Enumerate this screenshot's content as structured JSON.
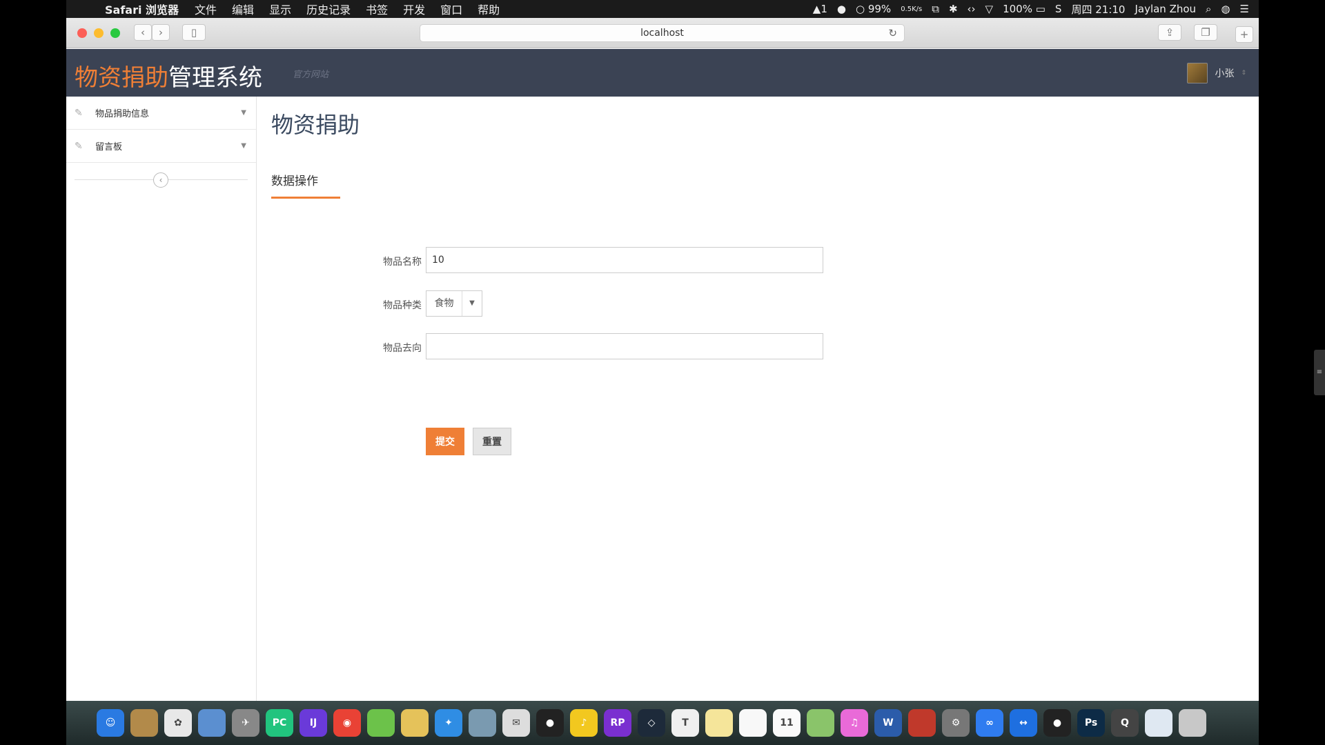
{
  "menubar": {
    "app_name": "Safari 浏览器",
    "items": [
      "文件",
      "编辑",
      "显示",
      "历史记录",
      "书签",
      "开发",
      "窗口",
      "帮助"
    ],
    "status": {
      "notif_count": "1",
      "battery_small": "99%",
      "net_rate": "0.5K/s",
      "battery": "100%",
      "datetime": "周四 21:10",
      "user": "Jaylan Zhou"
    }
  },
  "browser": {
    "url": "localhost"
  },
  "header": {
    "brand_accent": "物资捐助",
    "brand_rest": "管理系统",
    "official_site": "官方网站",
    "user_name": "小张"
  },
  "sidebar": {
    "items": [
      {
        "label": "物品捐助信息"
      },
      {
        "label": "留言板"
      }
    ]
  },
  "main": {
    "title": "物资捐助",
    "tab_label": "数据操作",
    "form": {
      "item_name_label": "物品名称",
      "item_name_value": "10",
      "item_type_label": "物品种类",
      "item_type_value": "食物",
      "item_dest_label": "物品去向",
      "item_dest_value": "",
      "submit_label": "提交",
      "reset_label": "重置"
    }
  },
  "dock": {
    "apps": [
      {
        "icon": "finder-icon",
        "glyph": "☺",
        "color": "#2a7ae2"
      },
      {
        "icon": "notes-brown-icon",
        "glyph": "",
        "color": "#b28a4a"
      },
      {
        "icon": "photos-icon",
        "glyph": "✿",
        "color": "#e8e8e8"
      },
      {
        "icon": "preview-icon",
        "glyph": "",
        "color": "#5b8fd0"
      },
      {
        "icon": "launchpad-icon",
        "glyph": "✈",
        "color": "#888"
      },
      {
        "icon": "pycharm-icon",
        "glyph": "PC",
        "color": "#21c47e"
      },
      {
        "icon": "intellij-icon",
        "glyph": "IJ",
        "color": "#6a3ad9"
      },
      {
        "icon": "chrome-icon",
        "glyph": "◉",
        "color": "#e94235"
      },
      {
        "icon": "leaf-icon",
        "glyph": "",
        "color": "#6cc24a"
      },
      {
        "icon": "peanut-icon",
        "glyph": "",
        "color": "#e5c25a"
      },
      {
        "icon": "safari-icon",
        "glyph": "✦",
        "color": "#2f8de4"
      },
      {
        "icon": "network-icon",
        "glyph": "",
        "color": "#7a9ab0"
      },
      {
        "icon": "wechat-icon",
        "glyph": "✉",
        "color": "#ddd"
      },
      {
        "icon": "qq-icon",
        "glyph": "●",
        "color": "#222"
      },
      {
        "icon": "music-icon",
        "glyph": "♪",
        "color": "#f2c81f"
      },
      {
        "icon": "axure-icon",
        "glyph": "RP",
        "color": "#7a2fd0"
      },
      {
        "icon": "unity-icon",
        "glyph": "◇",
        "color": "#1d2a3a"
      },
      {
        "icon": "typora-icon",
        "glyph": "T",
        "color": "#f0f0f0"
      },
      {
        "icon": "stickies-icon",
        "glyph": "",
        "color": "#f5e59a"
      },
      {
        "icon": "reminders-icon",
        "glyph": "",
        "color": "#f8f8f8"
      },
      {
        "icon": "calendar-icon",
        "glyph": "11",
        "color": "#fafafa"
      },
      {
        "icon": "maps-icon",
        "glyph": "",
        "color": "#8ac46a"
      },
      {
        "icon": "itunes-icon",
        "glyph": "♫",
        "color": "#e96ad8"
      },
      {
        "icon": "word-icon",
        "glyph": "W",
        "color": "#2b5caa"
      },
      {
        "icon": "filezilla-icon",
        "glyph": "",
        "color": "#c0392b"
      },
      {
        "icon": "system-prefs-icon",
        "glyph": "⚙",
        "color": "#777"
      },
      {
        "icon": "baidu-netdisk-icon",
        "glyph": "∞",
        "color": "#2f7cf0"
      },
      {
        "icon": "teamviewer-icon",
        "glyph": "↔",
        "color": "#1e6fe0"
      },
      {
        "icon": "qq-alt-icon",
        "glyph": "●",
        "color": "#222"
      },
      {
        "icon": "photoshop-icon",
        "glyph": "Ps",
        "color": "#0d2b46"
      },
      {
        "icon": "quicktime-icon",
        "glyph": "Q",
        "color": "#444"
      },
      {
        "icon": "documents-icon",
        "glyph": "",
        "color": "#dfe8f2"
      },
      {
        "icon": "trash-icon",
        "glyph": "",
        "color": "#c8c8c8"
      }
    ]
  }
}
